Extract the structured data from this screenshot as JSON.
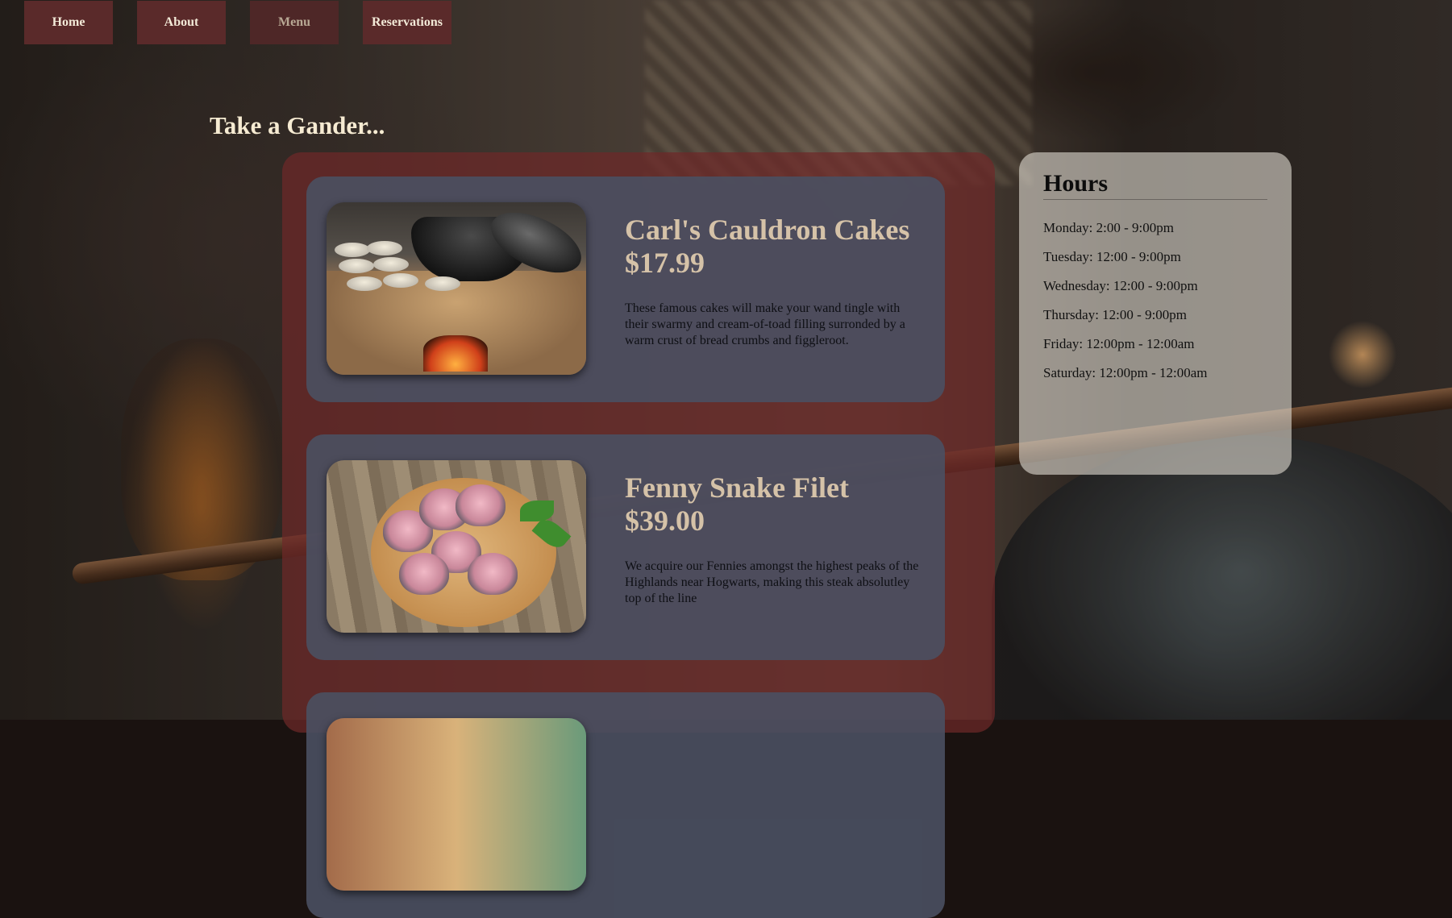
{
  "nav": {
    "items": [
      {
        "label": "Home"
      },
      {
        "label": "About"
      },
      {
        "label": "Menu"
      },
      {
        "label": "Reservations"
      }
    ]
  },
  "page": {
    "title": "Take a Gander..."
  },
  "menu": {
    "items": [
      {
        "name": "Carl's Cauldron Cakes",
        "price": "$17.99",
        "description": "These famous cakes will make your wand tingle with their swarmy and cream-of-toad filling surronded by a warm crust of bread crumbs and figgleroot."
      },
      {
        "name": "Fenny Snake Filet",
        "price": "$39.00",
        "description": "We acquire our Fennies amongst the highest peaks of the Highlands near Hogwarts, making this steak absolutley top of the line"
      }
    ]
  },
  "hours": {
    "title": "Hours",
    "days": [
      "Monday: 2:00 - 9:00pm",
      "Tuesday: 12:00 - 9:00pm",
      "Wednesday: 12:00 - 9:00pm",
      "Thursday: 12:00 - 9:00pm",
      "Friday: 12:00pm - 12:00am",
      "Saturday: 12:00pm - 12:00am"
    ]
  },
  "colors": {
    "nav_bg": "#5a2a2a",
    "title_text": "#f6ebd2",
    "menu_panel": "#6e2828",
    "menu_card": "#4a5062",
    "dish_heading": "#d5c2a8"
  }
}
